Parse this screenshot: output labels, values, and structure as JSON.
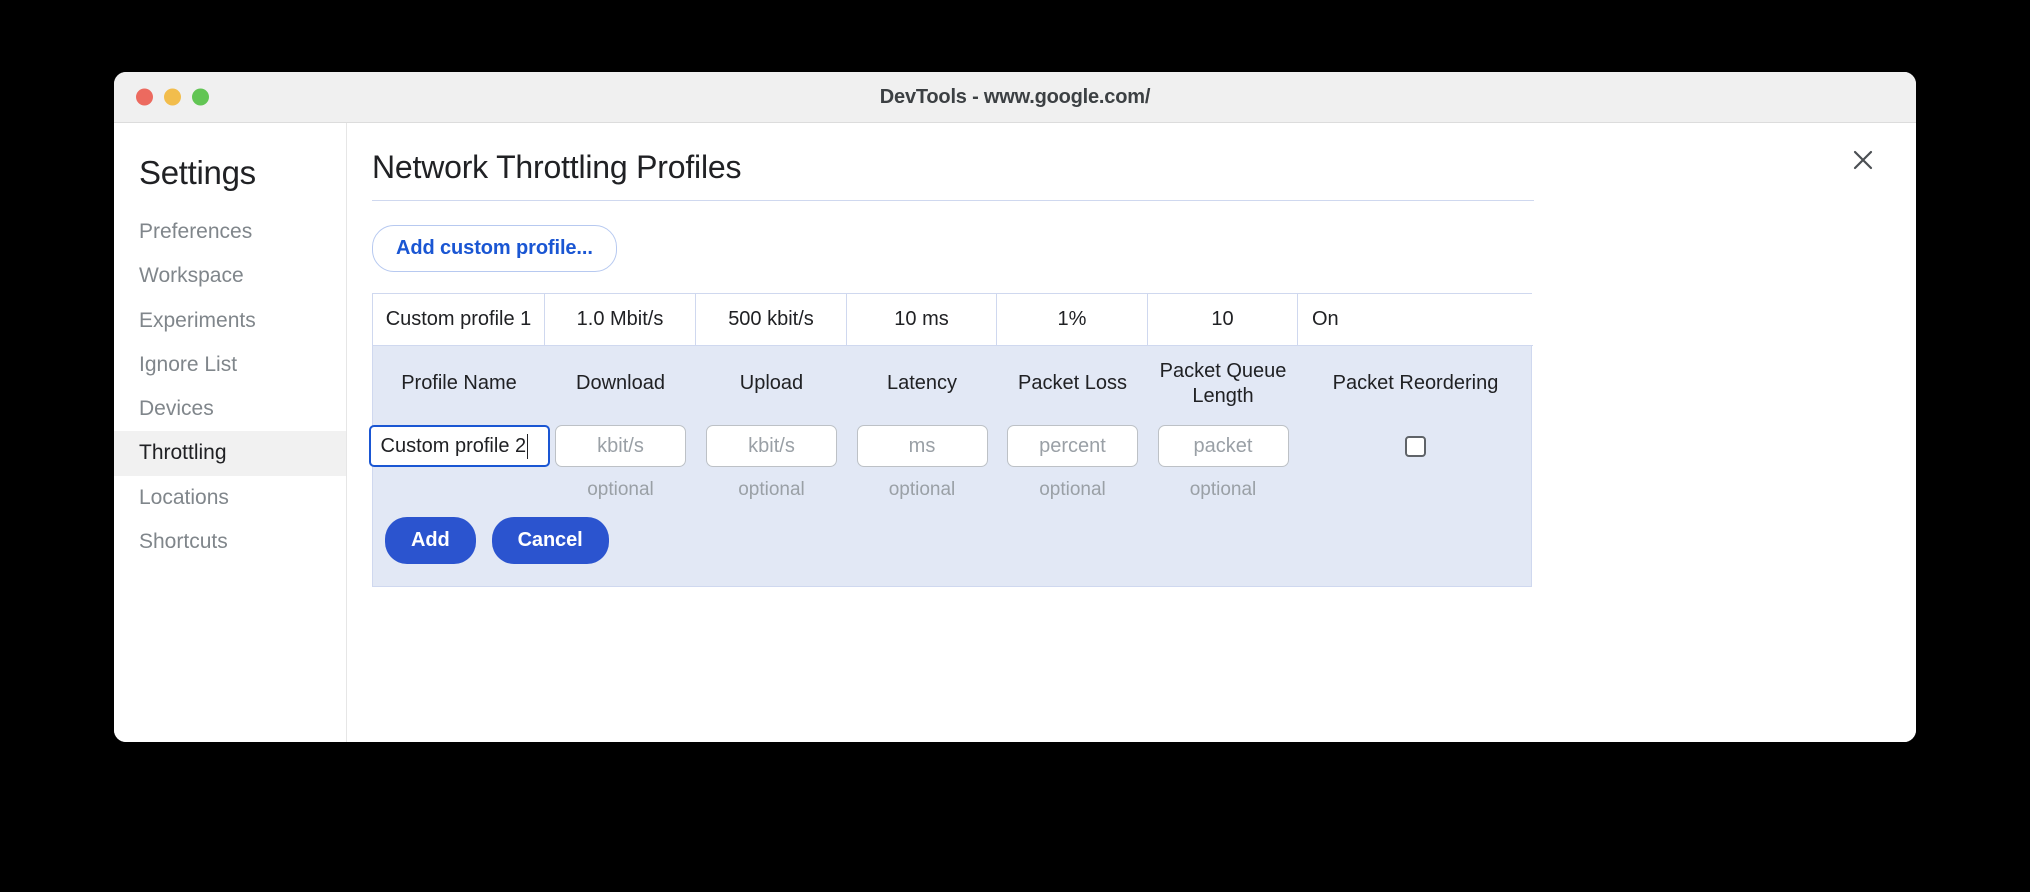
{
  "window": {
    "title": "DevTools - www.google.com/",
    "traffic_lights": [
      "close",
      "minimize",
      "zoom"
    ]
  },
  "sidebar": {
    "heading": "Settings",
    "items": [
      {
        "label": "Preferences",
        "selected": false
      },
      {
        "label": "Workspace",
        "selected": false
      },
      {
        "label": "Experiments",
        "selected": false
      },
      {
        "label": "Ignore List",
        "selected": false
      },
      {
        "label": "Devices",
        "selected": false
      },
      {
        "label": "Throttling",
        "selected": true
      },
      {
        "label": "Locations",
        "selected": false
      },
      {
        "label": "Shortcuts",
        "selected": false
      }
    ]
  },
  "content": {
    "panel_title": "Network Throttling Profiles",
    "close_icon": "close-icon",
    "add_profile_button": "Add custom profile...",
    "table": {
      "existing_row": [
        "Custom profile 1",
        "1.0 Mbit/s",
        "500 kbit/s",
        "10 ms",
        "1%",
        "10",
        "On"
      ],
      "headers": [
        "Profile Name",
        "Download",
        "Upload",
        "Latency",
        "Packet Loss",
        "Packet Queue Length",
        "Packet Reordering"
      ],
      "inputs": {
        "profile_name_value": "Custom profile 2",
        "download_placeholder": "kbit/s",
        "upload_placeholder": "kbit/s",
        "latency_placeholder": "ms",
        "packet_loss_placeholder": "percent",
        "packet_queue_placeholder": "packet",
        "packet_reordering_checked": false
      },
      "optional_labels": [
        "optional",
        "optional",
        "optional",
        "optional",
        "optional"
      ]
    },
    "actions": {
      "add": "Add",
      "cancel": "Cancel"
    }
  },
  "colors": {
    "accent_blue": "#2b54cf",
    "link_blue": "#1a56d3",
    "form_background": "#e2e8f5",
    "table_border": "#cfd8ef",
    "selected_nav": "#f1f1f1"
  }
}
